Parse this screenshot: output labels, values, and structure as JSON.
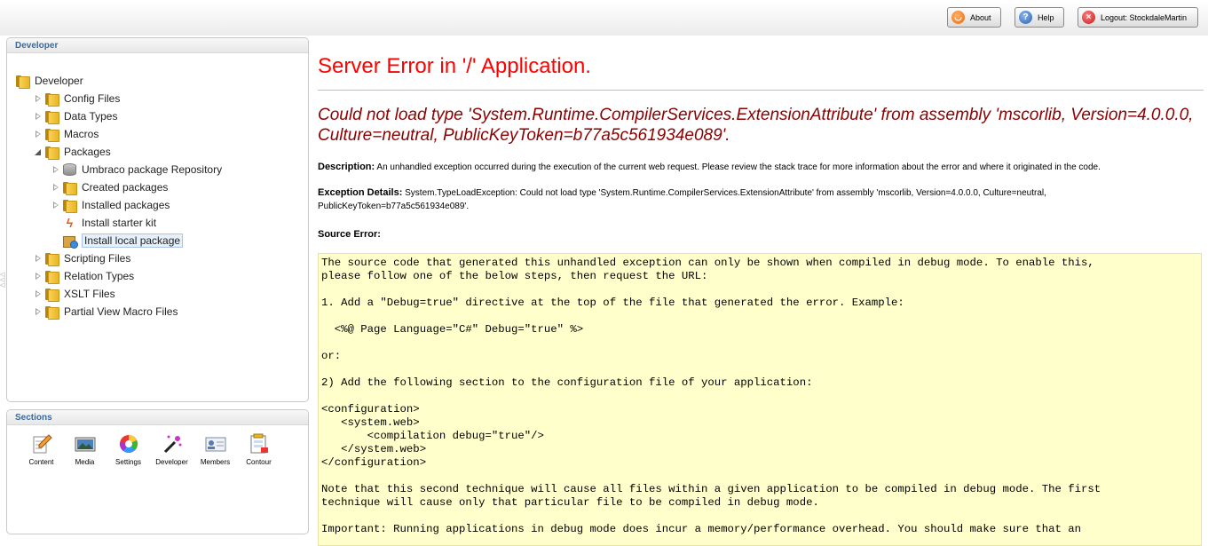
{
  "topbar": {
    "about_label": "About",
    "help_label": "Help",
    "logout_label": "Logout: StockdaleMartin"
  },
  "tree_panel": {
    "title": "Developer",
    "items": [
      {
        "label": "Developer",
        "level": 0,
        "arrow": "none",
        "icon": "folder-icon"
      },
      {
        "label": "Config Files",
        "level": 1,
        "arrow": "closed",
        "icon": "folder-icon"
      },
      {
        "label": "Data Types",
        "level": 1,
        "arrow": "closed",
        "icon": "folder-icon"
      },
      {
        "label": "Macros",
        "level": 1,
        "arrow": "closed",
        "icon": "folder-icon"
      },
      {
        "label": "Packages",
        "level": 1,
        "arrow": "open",
        "icon": "folder-icon"
      },
      {
        "label": "Umbraco package Repository",
        "level": 2,
        "arrow": "closed",
        "icon": "database-icon"
      },
      {
        "label": "Created packages",
        "level": 2,
        "arrow": "closed",
        "icon": "folder-icon"
      },
      {
        "label": "Installed packages",
        "level": 2,
        "arrow": "closed",
        "icon": "folder-icon"
      },
      {
        "label": "Install starter kit",
        "level": 2,
        "arrow": "none",
        "icon": "lightning-icon"
      },
      {
        "label": "Install local package",
        "level": 2,
        "arrow": "none",
        "icon": "package-icon",
        "selected": true
      },
      {
        "label": "Scripting Files",
        "level": 1,
        "arrow": "closed",
        "icon": "folder-icon"
      },
      {
        "label": "Relation Types",
        "level": 1,
        "arrow": "closed",
        "icon": "folder-icon"
      },
      {
        "label": "XSLT Files",
        "level": 1,
        "arrow": "closed",
        "icon": "folder-icon"
      },
      {
        "label": "Partial View Macro Files",
        "level": 1,
        "arrow": "closed",
        "icon": "folder-icon"
      }
    ]
  },
  "sections_panel": {
    "title": "Sections",
    "items": [
      {
        "label": "Content",
        "icon": "pencil-document-icon"
      },
      {
        "label": "Media",
        "icon": "picture-icon"
      },
      {
        "label": "Settings",
        "icon": "color-wheel-icon"
      },
      {
        "label": "Developer",
        "icon": "magic-wand-icon"
      },
      {
        "label": "Members",
        "icon": "members-card-icon"
      },
      {
        "label": "Contour",
        "icon": "form-icon"
      }
    ]
  },
  "error": {
    "title": "Server Error in '/' Application.",
    "message": "Could not load type 'System.Runtime.CompilerServices.ExtensionAttribute' from assembly 'mscorlib, Version=4.0.0.0, Culture=neutral, PublicKeyToken=b77a5c561934e089'.",
    "description_label": "Description:",
    "description_text": "An unhandled exception occurred during the execution of the current web request. Please review the stack trace for more information about the error and where it originated in the code.",
    "exception_label": "Exception Details:",
    "exception_text": "System.TypeLoadException: Could not load type 'System.Runtime.CompilerServices.ExtensionAttribute' from assembly 'mscorlib, Version=4.0.0.0, Culture=neutral, PublicKeyToken=b77a5c561934e089'.",
    "source_error_label": "Source Error:",
    "code_lines": [
      "The source code that generated this unhandled exception can only be shown when compiled in debug mode. To enable this,",
      "please follow one of the below steps, then request the URL:",
      "",
      "1. Add a \"Debug=true\" directive at the top of the file that generated the error. Example:",
      "",
      "  <%@ Page Language=\"C#\" Debug=\"true\" %>",
      "",
      "or:",
      "",
      "2) Add the following section to the configuration file of your application:",
      "",
      "<configuration>",
      "   <system.web>",
      "       <compilation debug=\"true\"/>",
      "   </system.web>",
      "</configuration>",
      "",
      "Note that this second technique will cause all files within a given application to be compiled in debug mode. The first",
      "technique will cause only that particular file to be compiled in debug mode.",
      "",
      "Important: Running applications in debug mode does incur a memory/performance overhead. You should make sure that an"
    ]
  }
}
